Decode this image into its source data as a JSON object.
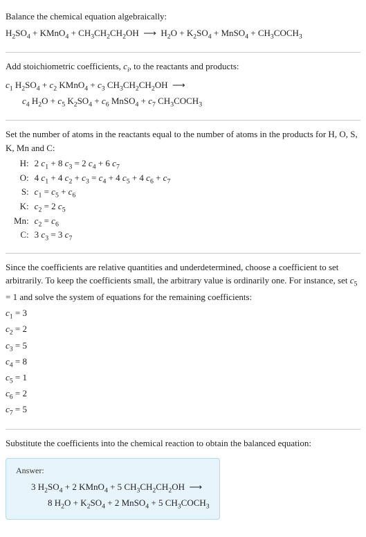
{
  "intro": {
    "line1": "Balance the chemical equation algebraically:",
    "equation_left": "H₂SO₄ + KMnO₄ + CH₃CH₂CH₂OH",
    "equation_right": "H₂O + K₂SO₄ + MnSO₄ + CH₃COCH₃"
  },
  "stoich": {
    "line1_a": "Add stoichiometric coefficients, ",
    "line1_b": ", to the reactants and products:",
    "ci": "cᵢ",
    "eq_line1": "c₁ H₂SO₄ + c₂ KMnO₄ + c₃ CH₃CH₂CH₂OH  ⟶",
    "eq_line2": "c₄ H₂O + c₅ K₂SO₄ + c₆ MnSO₄ + c₇ CH₃COCH₃"
  },
  "atoms": {
    "intro": "Set the number of atoms in the reactants equal to the number of atoms in the products for H, O, S, K, Mn and C:",
    "rows": [
      {
        "el": "H:",
        "eq": "2 c₁ + 8 c₃ = 2 c₄ + 6 c₇"
      },
      {
        "el": "O:",
        "eq": "4 c₁ + 4 c₂ + c₃ = c₄ + 4 c₅ + 4 c₆ + c₇"
      },
      {
        "el": "S:",
        "eq": "c₁ = c₅ + c₆"
      },
      {
        "el": "K:",
        "eq": "c₂ = 2 c₅"
      },
      {
        "el": "Mn:",
        "eq": "c₂ = c₆"
      },
      {
        "el": "C:",
        "eq": "3 c₃ = 3 c₇"
      }
    ]
  },
  "solve": {
    "intro": "Since the coefficients are relative quantities and underdetermined, choose a coefficient to set arbitrarily. To keep the coefficients small, the arbitrary value is ordinarily one. For instance, set c₅ = 1 and solve the system of equations for the remaining coefficients:",
    "coefs": [
      "c₁ = 3",
      "c₂ = 2",
      "c₃ = 5",
      "c₄ = 8",
      "c₅ = 1",
      "c₆ = 2",
      "c₇ = 5"
    ]
  },
  "subst": {
    "intro": "Substitute the coefficients into the chemical reaction to obtain the balanced equation:"
  },
  "answer": {
    "label": "Answer:",
    "line1": "3 H₂SO₄ + 2 KMnO₄ + 5 CH₃CH₂CH₂OH  ⟶",
    "line2": "8 H₂O + K₂SO₄ + 2 MnSO₄ + 5 CH₃COCH₃"
  }
}
